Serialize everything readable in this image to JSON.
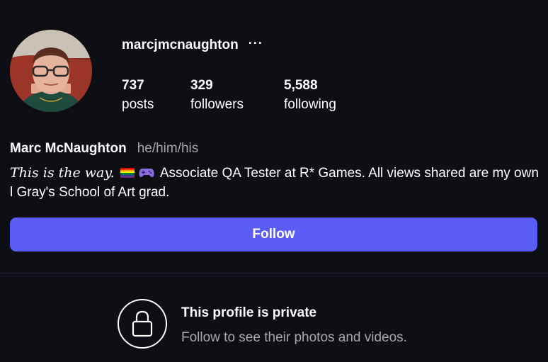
{
  "profile": {
    "username": "marcjmcnaughton",
    "more_label": "···",
    "avatar_icon": "profile-photo",
    "stats": {
      "posts_count": "737",
      "posts_label": "posts",
      "followers_count": "329",
      "followers_label": "followers",
      "following_count": "5,588",
      "following_label": "following"
    },
    "full_name": "Marc McNaughton",
    "pronouns": "he/him/his",
    "bio": {
      "motto": "This is the way.",
      "flag_icon": "rainbow-flag",
      "gamepad_icon": "video-game-controller",
      "text": "Associate QA Tester at R* Games. All views shared are my own l Gray's School of Art grad."
    },
    "follow_label": "Follow"
  },
  "private_notice": {
    "icon": "lock-icon",
    "title": "This profile is private",
    "subtitle": "Follow to see their photos and videos."
  },
  "colors": {
    "background": "#0e0f15",
    "accent": "#5a5cf6",
    "secondary_text": "#a8a8a8"
  }
}
